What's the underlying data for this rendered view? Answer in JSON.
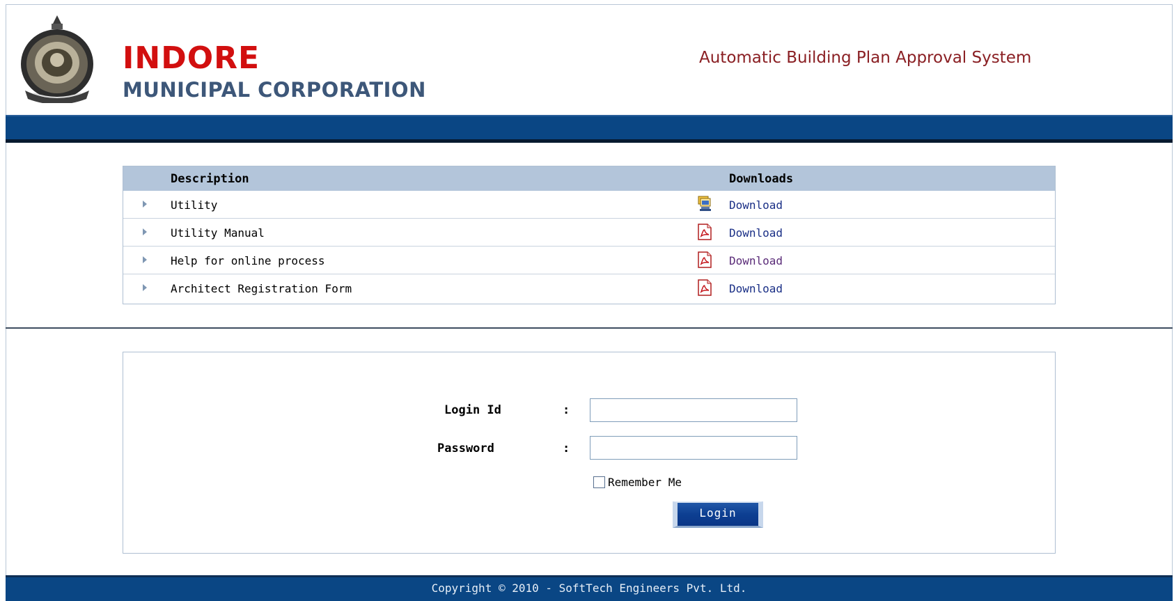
{
  "header": {
    "brand_line1": "INDORE",
    "brand_line2": "MUNICIPAL CORPORATION",
    "system_title": "Automatic Building Plan Approval System",
    "logo_icon": "municipal-emblem-icon",
    "colors": {
      "brand_red": "#d20f0f",
      "brand_blue": "#3d5779",
      "title_maroon": "#8a1f23",
      "bar_blue": "#0a4684"
    }
  },
  "downloads": {
    "col_description": "Description",
    "col_downloads": "Downloads",
    "rows": [
      {
        "description": "Utility",
        "icon": "setup-computer-icon",
        "link": "Download",
        "visited": false
      },
      {
        "description": "Utility Manual",
        "icon": "pdf-icon",
        "link": "Download",
        "visited": false
      },
      {
        "description": "Help for online process",
        "icon": "pdf-icon",
        "link": "Download",
        "visited": true
      },
      {
        "description": "Architect Registration Form",
        "icon": "pdf-icon",
        "link": "Download",
        "visited": false
      }
    ]
  },
  "login": {
    "login_id_label": "Login Id",
    "password_label": "Password",
    "colon": ":",
    "login_id_value": "",
    "password_value": "",
    "remember_label": "Remember Me",
    "remember_checked": false,
    "button_label": "Login"
  },
  "footer": {
    "copyright": "Copyright © 2010 - SoftTech Engineers Pvt. Ltd."
  }
}
